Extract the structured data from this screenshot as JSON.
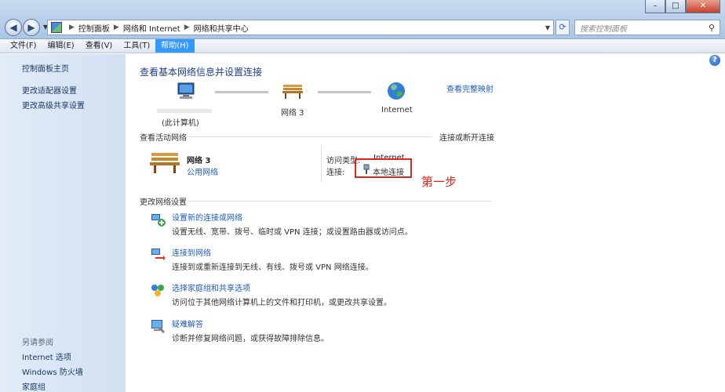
{
  "window": {
    "controls": [
      "–",
      "□",
      "✕"
    ]
  },
  "address": {
    "crumbs": [
      "控制面板",
      "网络和 Internet",
      "网络和共享中心"
    ],
    "refresh_icon": "refresh-icon"
  },
  "search": {
    "placeholder": "搜索控制面板"
  },
  "menu": [
    {
      "label": "文件(F)"
    },
    {
      "label": "编辑(E)"
    },
    {
      "label": "查看(V)"
    },
    {
      "label": "工具(T)"
    },
    {
      "label": "帮助(H)"
    }
  ],
  "sidebar": {
    "links": [
      "控制面板主页",
      "更改适配器设置",
      "更改高级共享设置"
    ],
    "see_also_header": "另请参阅",
    "see_also": [
      "Internet 选项",
      "Windows 防火墙",
      "家庭组"
    ]
  },
  "main": {
    "help_glyph": "?",
    "title": "查看基本网络信息并设置连接",
    "full_map_link": "查看完整映射",
    "map": {
      "computer_label": "(此计算机)",
      "network_label": "网络  3",
      "internet_label": "Internet"
    },
    "active_networks": {
      "header": "查看活动网络",
      "connect_link": "连接或断开连接",
      "network_name": "网络  3",
      "network_type": "公用网络",
      "access_type_label": "访问类型:",
      "access_type_value": "Internet",
      "connection_label": "连接:",
      "connection_value": "本地连接"
    },
    "annotation": "第一步",
    "change_settings": {
      "header": "更改网络设置",
      "tasks": [
        {
          "link": "设置新的连接或网络",
          "desc": "设置无线、宽带、拨号、临时或 VPN 连接；或设置路由器或访问点。"
        },
        {
          "link": "连接到网络",
          "desc": "连接到或重新连接到无线、有线、拨号或 VPN 网络连接。"
        },
        {
          "link": "选择家庭组和共享选项",
          "desc": "访问位于其他网络计算机上的文件和打印机，或更改共享设置。"
        },
        {
          "link": "疑难解答",
          "desc": "诊断并修复网络问题，或获得故障排除信息。"
        }
      ]
    }
  },
  "colors": {
    "link": "#1f5bb8",
    "title": "#1e3f8a",
    "annotation": "#d9261c",
    "menu_active": "#3399ff"
  }
}
